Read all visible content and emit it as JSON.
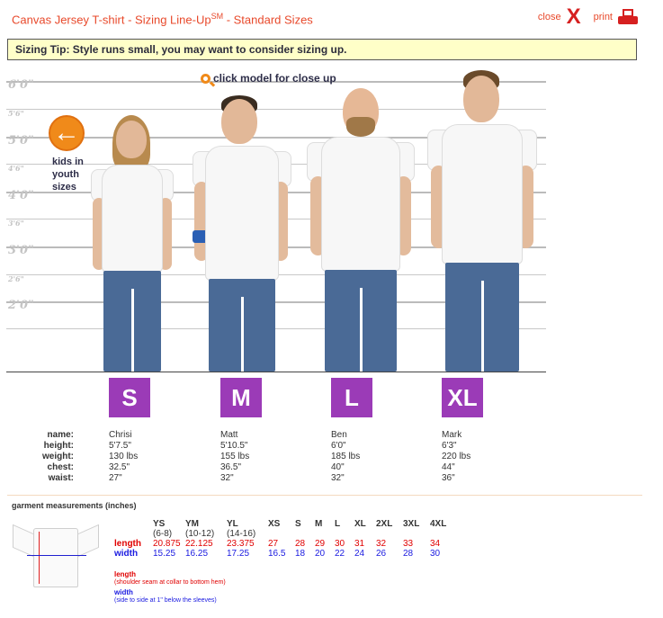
{
  "header": {
    "title": "Canvas Jersey T-shirt - Sizing Line-Up",
    "title_sup": "SM",
    "title_suffix": " - Standard Sizes",
    "close_label": "close",
    "close_glyph": "X",
    "print_label": "print"
  },
  "tip": "Sizing Tip: Style runs small, you may want to consider sizing up.",
  "zoom_hint": "click model for close up",
  "kids": {
    "arrow": "←",
    "label": "kids in youth sizes"
  },
  "height_labels": {
    "h6": "6'0\"",
    "h56": "5'6\"",
    "h5": "5'0\"",
    "h46": "4'6\"",
    "h4": "4'0\"",
    "h36": "3'6\"",
    "h3": "3'0\"",
    "h26": "2'6\"",
    "h2": "2'0\""
  },
  "models": [
    {
      "size": "S",
      "name": "Chrisi",
      "height": "5'7.5\"",
      "weight": "130 lbs",
      "chest": "32.5\"",
      "waist": "27\""
    },
    {
      "size": "M",
      "name": "Matt",
      "height": "5'10.5\"",
      "weight": "155 lbs",
      "chest": "36.5\"",
      "waist": "32\""
    },
    {
      "size": "L",
      "name": "Ben",
      "height": "6'0\"",
      "weight": "185 lbs",
      "chest": "40\"",
      "waist": "32\""
    },
    {
      "size": "XL",
      "name": "Mark",
      "height": "6'3\"",
      "weight": "220 lbs",
      "chest": "44\"",
      "waist": "36\""
    }
  ],
  "info_labels": {
    "name": "name:",
    "height": "height:",
    "weight": "weight:",
    "chest": "chest:",
    "waist": "waist:"
  },
  "garment": {
    "title": "garment measurements (inches)",
    "headers": [
      "YS",
      "YM",
      "YL",
      "XS",
      "S",
      "M",
      "L",
      "XL",
      "2XL",
      "3XL",
      "4XL"
    ],
    "subheaders": [
      "(6-8)",
      "(10-12)",
      "(14-16)",
      "",
      "",
      "",
      "",
      "",
      "",
      "",
      ""
    ],
    "length_label": "length",
    "width_label": "width",
    "length": [
      "20.875",
      "22.125",
      "23.375",
      "27",
      "28",
      "29",
      "30",
      "31",
      "32",
      "33",
      "34"
    ],
    "width": [
      "15.25",
      "16.25",
      "17.25",
      "16.5",
      "18",
      "20",
      "22",
      "24",
      "26",
      "28",
      "30"
    ],
    "legend_length_title": "length",
    "legend_length_desc": "(shoulder seam at collar to bottom hem)",
    "legend_width_title": "width",
    "legend_width_desc": "(side to side at 1\" below the sleeves)"
  },
  "colors": {
    "accent": "#e8492b",
    "size_badge": "#9b3bb7",
    "tip_bg": "#ffffc8",
    "length": "#e00000",
    "width": "#1a1ae0",
    "orange": "#f08a1a"
  }
}
